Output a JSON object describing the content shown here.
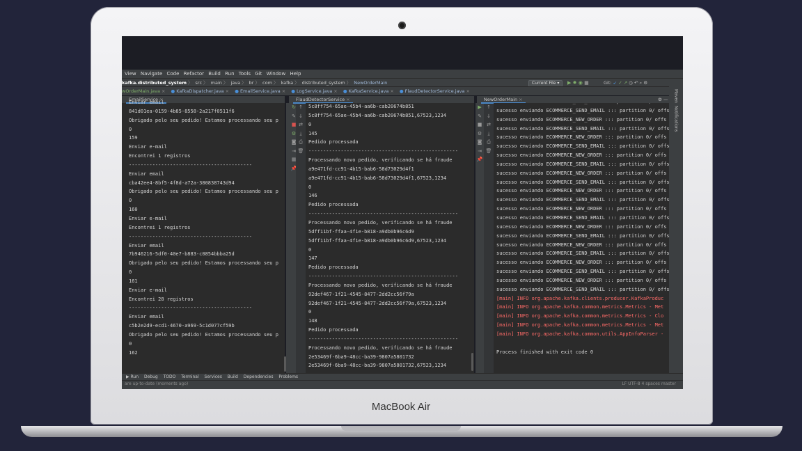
{
  "device": {
    "brand": "MacBook Air"
  },
  "menu": [
    "View",
    "Navigate",
    "Code",
    "Refactor",
    "Build",
    "Run",
    "Tools",
    "Git",
    "Window",
    "Help"
  ],
  "breadcrumb": [
    "kafka.distributed_system",
    "src",
    "main",
    "java",
    "br",
    "com",
    "kafka",
    "distributed_system",
    "NewOrderMain"
  ],
  "toolbar": {
    "run_config": "Current File ▾",
    "git_label": "Git:"
  },
  "editor_tabs": [
    "wOrderMain.java",
    "KafkaDispatcher.java",
    "EmailService.java",
    "LogService.java",
    "KafkaService.java",
    "FlaudDetectorService.java"
  ],
  "panels": {
    "email": {
      "tab": "EmailService",
      "lines": [
        "Enviar email",
        "841d01ea-0159-4b85-8558-2a217f0511f6",
        "Obrigado pelo seu pedido! Estamos processando seu p",
        "0",
        "159",
        "Enviar e-mail",
        "Encontrei 1 registros",
        "------------------------------------------",
        "Enviar email",
        "cba42ee4-8bf5-4f8d-a72a-380838743d94",
        "Obrigado pelo seu pedido! Estamos processando seu p",
        "0",
        "160",
        "Enviar e-mail",
        "Encontrei 1 registros",
        "------------------------------------------",
        "Enviar email",
        "7b946216-5df0-40e7-b883-c0854bbba25d",
        "Obrigado pelo seu pedido! Estamos processando seu p",
        "0",
        "161",
        "Enviar e-mail",
        "Encontrei 28 registros",
        "------------------------------------------",
        "Enviar email",
        "c5b2e2d9-ecd1-4670-a969-5c1d077cf59b",
        "Obrigado pelo seu pedido! Estamos processando seu p",
        "0",
        "162"
      ]
    },
    "fraud": {
      "tab": "FlaudDetectorService",
      "lines": [
        "5c8ff754-65ae-45b4-aa6b-cab20674b851",
        "5c8ff754-65ae-45b4-aa6b-cab20674b851,67523,1234",
        "0",
        "145",
        "Pedido processada",
        "---------------------------------------------------",
        "Processando novo pedido, verificando se há fraude",
        "a9e471fd-cc91-4b15-bab6-58d73029d4f1",
        "a9e471fd-cc91-4b15-bab6-58d73029d4f1,67523,1234",
        "0",
        "146",
        "Pedido processada",
        "---------------------------------------------------",
        "Processando novo pedido, verificando se há fraude",
        "5dff11bf-ffaa-4f1e-b818-a9db0b96c6d9",
        "5dff11bf-ffaa-4f1e-b818-a9db0b96c6d9,67523,1234",
        "0",
        "147",
        "Pedido processada",
        "---------------------------------------------------",
        "Processando novo pedido, verificando se há fraude",
        "92def467-1f21-4545-8477-2dd2cc56f79a",
        "92def467-1f21-4545-8477-2dd2cc56f79a,67523,1234",
        "0",
        "148",
        "Pedido processada",
        "---------------------------------------------------",
        "Processando novo pedido, verificando se há fraude",
        "2e53469f-6ba9-48cc-ba39-9807a5801732",
        "2e53469f-6ba9-48cc-ba39-9807a5801732,67523,1234"
      ]
    },
    "neworder": {
      "tab": "NewOrderMain",
      "lines": [
        "sucesso enviando ECOMMERCE_NEW_ORDER ::: partition 0/ offs",
        "sucesso enviando ECOMMERCE_SEND_EMAIL ::: partition 0/ offs",
        "sucesso enviando ECOMMERCE_NEW_ORDER ::: partition 0/ offs",
        "sucesso enviando ECOMMERCE_SEND_EMAIL ::: partition 0/ offs",
        "sucesso enviando ECOMMERCE_NEW_ORDER ::: partition 0/ offs",
        "sucesso enviando ECOMMERCE_SEND_EMAIL ::: partition 0/ offs",
        "sucesso enviando ECOMMERCE_NEW_ORDER ::: partition 0/ offs",
        "sucesso enviando ECOMMERCE_SEND_EMAIL ::: partition 0/ offs",
        "sucesso enviando ECOMMERCE_NEW_ORDER ::: partition 0/ offs",
        "sucesso enviando ECOMMERCE_SEND_EMAIL ::: partition 0/ offs",
        "sucesso enviando ECOMMERCE_NEW_ORDER ::: partition 0/ offs",
        "sucesso enviando ECOMMERCE_SEND_EMAIL ::: partition 0/ offs",
        "sucesso enviando ECOMMERCE_NEW_ORDER ::: partition 0/ offs",
        "sucesso enviando ECOMMERCE_SEND_EMAIL ::: partition 0/ offs",
        "sucesso enviando ECOMMERCE_NEW_ORDER ::: partition 0/ offs",
        "sucesso enviando ECOMMERCE_SEND_EMAIL ::: partition 0/ offs",
        "sucesso enviando ECOMMERCE_NEW_ORDER ::: partition 0/ offs",
        "sucesso enviando ECOMMERCE_SEND_EMAIL ::: partition 0/ offs",
        "sucesso enviando ECOMMERCE_NEW_ORDER ::: partition 0/ offs",
        "sucesso enviando ECOMMERCE_SEND_EMAIL ::: partition 0/ offs",
        "sucesso enviando ECOMMERCE_NEW_ORDER ::: partition 0/ offs",
        "sucesso enviando ECOMMERCE_SEND_EMAIL ::: partition 0/ offs",
        "[main] INFO org.apache.kafka.clients.producer.KafkaProduc",
        "[main] INFO org.apache.kafka.common.metrics.Metrics - Met",
        "[main] INFO org.apache.kafka.common.metrics.Metrics - Clo",
        "[main] INFO org.apache.kafka.common.metrics.Metrics - Met",
        "[main] INFO org.apache.kafka.common.utils.AppInfoParser -",
        "",
        "Process finished with exit code 0"
      ]
    }
  },
  "bottom_tools": [
    "▶ Run",
    "Debug",
    "TODO",
    "Terminal",
    "Services",
    "Build",
    "Dependencies",
    "Problems"
  ],
  "status": {
    "left": "are up-to-date (moments ago)",
    "right": "LF  UTF-8  4 spaces  master"
  },
  "right_strip": [
    "Maven",
    "Notifications"
  ]
}
